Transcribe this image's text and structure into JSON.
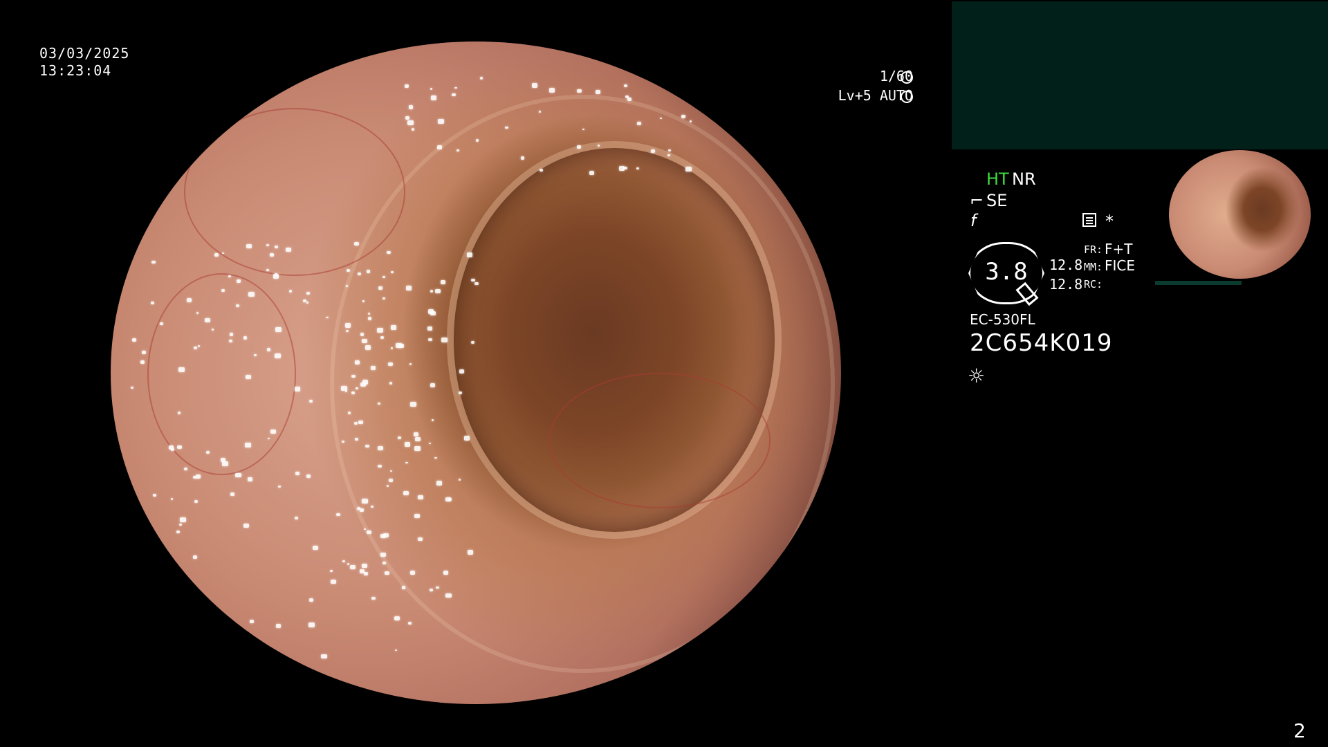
{
  "overlay": {
    "date": "03/03/2025",
    "time": "13:23:04",
    "shutter": "1/60",
    "level": "Lv+5 AUTO"
  },
  "status_panel": {
    "ht": "HT",
    "nr": "NR",
    "se": "SE",
    "zoom": "3.8",
    "value_1": "12.8",
    "value_2": "12.8",
    "fr_label": "FR:",
    "fr_value": "F+T",
    "mm_label": "MM:",
    "mm_value": "FICE",
    "rc_label": "RC:",
    "scope_model": "EC-530FL",
    "serial": "2C654K019"
  },
  "icons": {
    "shutter": "shutter-icon",
    "auto": "aperture-icon",
    "se": "stylus-icon",
    "f": "f-glyph-icon",
    "menu": "menu-icon",
    "star": "asterisk-icon",
    "light": "light-icon"
  },
  "page_number": "2"
}
